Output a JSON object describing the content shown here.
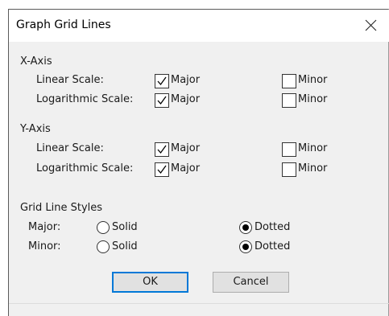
{
  "dialog": {
    "title": "Graph Grid Lines"
  },
  "icons": {
    "close": "close-icon",
    "check": "checkmark-icon"
  },
  "x_axis": {
    "heading": "X-Axis",
    "linear": {
      "label": "Linear Scale:",
      "major_label": "Major",
      "major_checked": true,
      "minor_label": "Minor",
      "minor_checked": false
    },
    "log": {
      "label": "Logarithmic Scale:",
      "major_label": "Major",
      "major_checked": true,
      "minor_label": "Minor",
      "minor_checked": false
    }
  },
  "y_axis": {
    "heading": "Y-Axis",
    "linear": {
      "label": "Linear Scale:",
      "major_label": "Major",
      "major_checked": true,
      "minor_label": "Minor",
      "minor_checked": false
    },
    "log": {
      "label": "Logarithmic Scale:",
      "major_label": "Major",
      "major_checked": true,
      "minor_label": "Minor",
      "minor_checked": false
    }
  },
  "styles": {
    "heading": "Grid Line Styles",
    "major": {
      "label": "Major:",
      "solid_label": "Solid",
      "dotted_label": "Dotted",
      "selected": "Dotted"
    },
    "minor": {
      "label": "Minor:",
      "solid_label": "Solid",
      "dotted_label": "Dotted",
      "selected": "Dotted"
    }
  },
  "buttons": {
    "ok": "OK",
    "cancel": "Cancel"
  },
  "colors": {
    "default_button_border": "#0078d7",
    "dialog_background": "#f0f0f0"
  }
}
